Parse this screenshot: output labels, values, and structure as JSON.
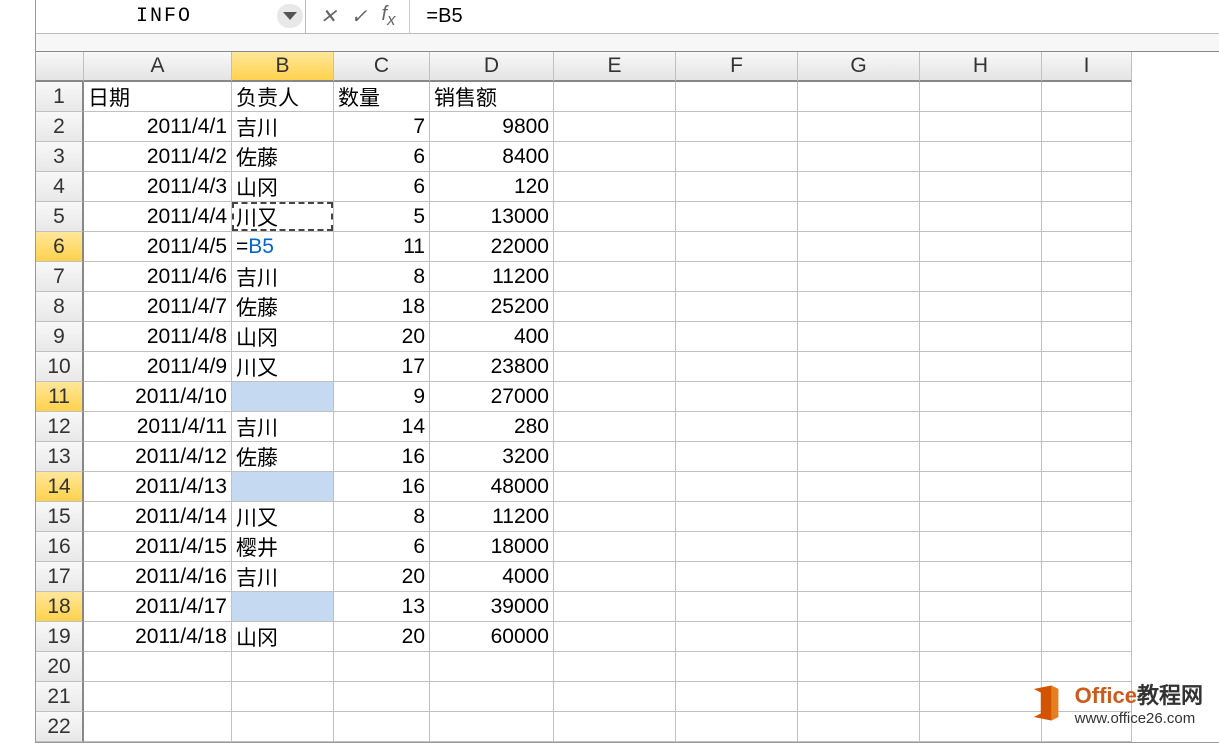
{
  "nameBox": "INFO",
  "formulaBar": "=B5",
  "columns": [
    "A",
    "B",
    "C",
    "D",
    "E",
    "F",
    "G",
    "H",
    "I"
  ],
  "activeColumn": "B",
  "activeRow": 6,
  "marchingCell": {
    "row": 5,
    "col": "B"
  },
  "highlightedRows": [
    11,
    14,
    18
  ],
  "highlightedCells": [
    {
      "row": 11,
      "col": "B"
    },
    {
      "row": 14,
      "col": "B"
    },
    {
      "row": 18,
      "col": "B"
    }
  ],
  "headers": {
    "A": "日期",
    "B": "负责人",
    "C": "数量",
    "D": "销售额"
  },
  "rows": [
    {
      "n": 1,
      "A": "日期",
      "B": "负责人",
      "C": "数量",
      "D": "销售额",
      "header": true
    },
    {
      "n": 2,
      "A": "2011/4/1",
      "B": "吉川",
      "C": "7",
      "D": "9800"
    },
    {
      "n": 3,
      "A": "2011/4/2",
      "B": "佐藤",
      "C": "6",
      "D": "8400"
    },
    {
      "n": 4,
      "A": "2011/4/3",
      "B": "山冈",
      "C": "6",
      "D": "120"
    },
    {
      "n": 5,
      "A": "2011/4/4",
      "B": "川又",
      "C": "5",
      "D": "13000"
    },
    {
      "n": 6,
      "A": "2011/4/5",
      "B": "=B5",
      "C": "11",
      "D": "22000",
      "editing": true
    },
    {
      "n": 7,
      "A": "2011/4/6",
      "B": "吉川",
      "C": "8",
      "D": "11200"
    },
    {
      "n": 8,
      "A": "2011/4/7",
      "B": "佐藤",
      "C": "18",
      "D": "25200"
    },
    {
      "n": 9,
      "A": "2011/4/8",
      "B": "山冈",
      "C": "20",
      "D": "400"
    },
    {
      "n": 10,
      "A": "2011/4/9",
      "B": "川又",
      "C": "17",
      "D": "23800"
    },
    {
      "n": 11,
      "A": "2011/4/10",
      "B": "",
      "C": "9",
      "D": "27000"
    },
    {
      "n": 12,
      "A": "2011/4/11",
      "B": "吉川",
      "C": "14",
      "D": "280"
    },
    {
      "n": 13,
      "A": "2011/4/12",
      "B": "佐藤",
      "C": "16",
      "D": "3200"
    },
    {
      "n": 14,
      "A": "2011/4/13",
      "B": "",
      "C": "16",
      "D": "48000"
    },
    {
      "n": 15,
      "A": "2011/4/14",
      "B": "川又",
      "C": "8",
      "D": "11200"
    },
    {
      "n": 16,
      "A": "2011/4/15",
      "B": "樱井",
      "C": "6",
      "D": "18000"
    },
    {
      "n": 17,
      "A": "2011/4/16",
      "B": "吉川",
      "C": "20",
      "D": "4000"
    },
    {
      "n": 18,
      "A": "2011/4/17",
      "B": "",
      "C": "13",
      "D": "39000"
    },
    {
      "n": 19,
      "A": "2011/4/18",
      "B": "山冈",
      "C": "20",
      "D": "60000"
    },
    {
      "n": 20,
      "A": "",
      "B": "",
      "C": "",
      "D": ""
    },
    {
      "n": 21,
      "A": "",
      "B": "",
      "C": "",
      "D": ""
    },
    {
      "n": 22,
      "A": "",
      "B": "",
      "C": "",
      "D": ""
    }
  ],
  "watermark": {
    "brand": "Office",
    "suffix": "教程网",
    "url": "www.office26.com"
  }
}
